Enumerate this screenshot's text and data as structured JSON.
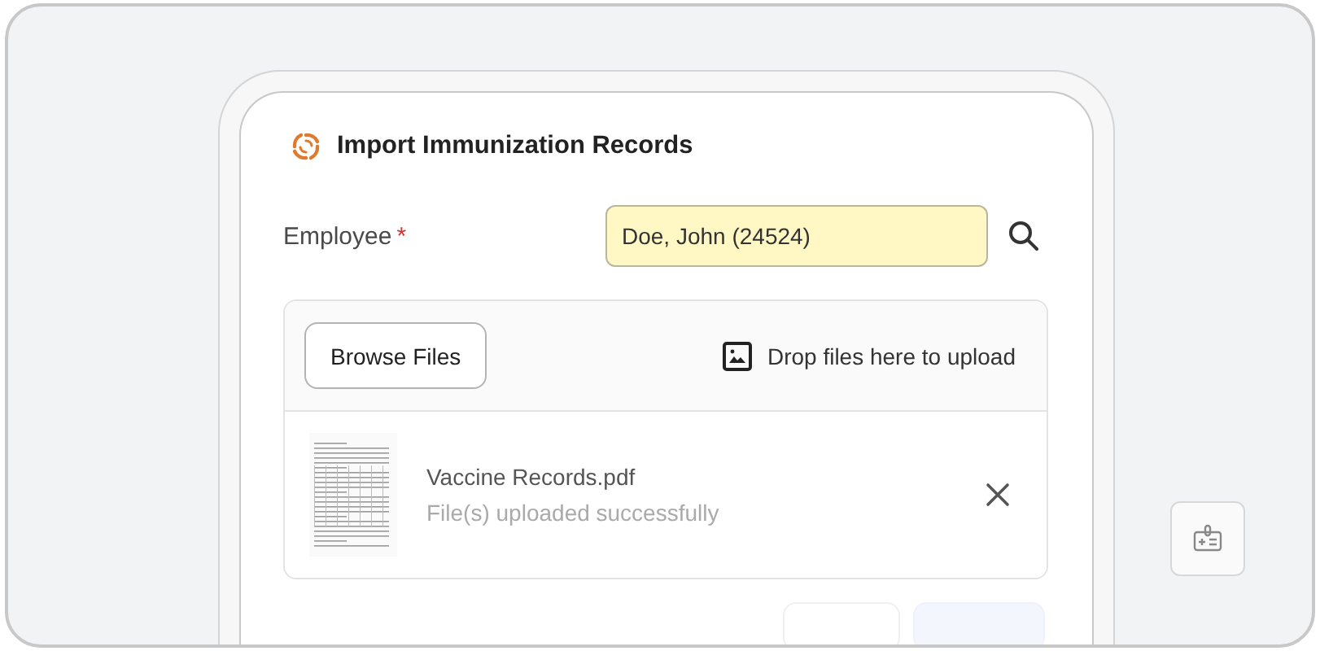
{
  "dialog": {
    "title": "Import Immunization Records",
    "employee": {
      "label": "Employee",
      "required_mark": "*",
      "value": "Doe, John (24524)"
    },
    "upload": {
      "browse_button": "Browse Files",
      "drop_hint": "Drop files here to upload",
      "files": [
        {
          "name": "Vaccine Records.pdf",
          "status": "File(s) uploaded successfully"
        }
      ]
    }
  }
}
